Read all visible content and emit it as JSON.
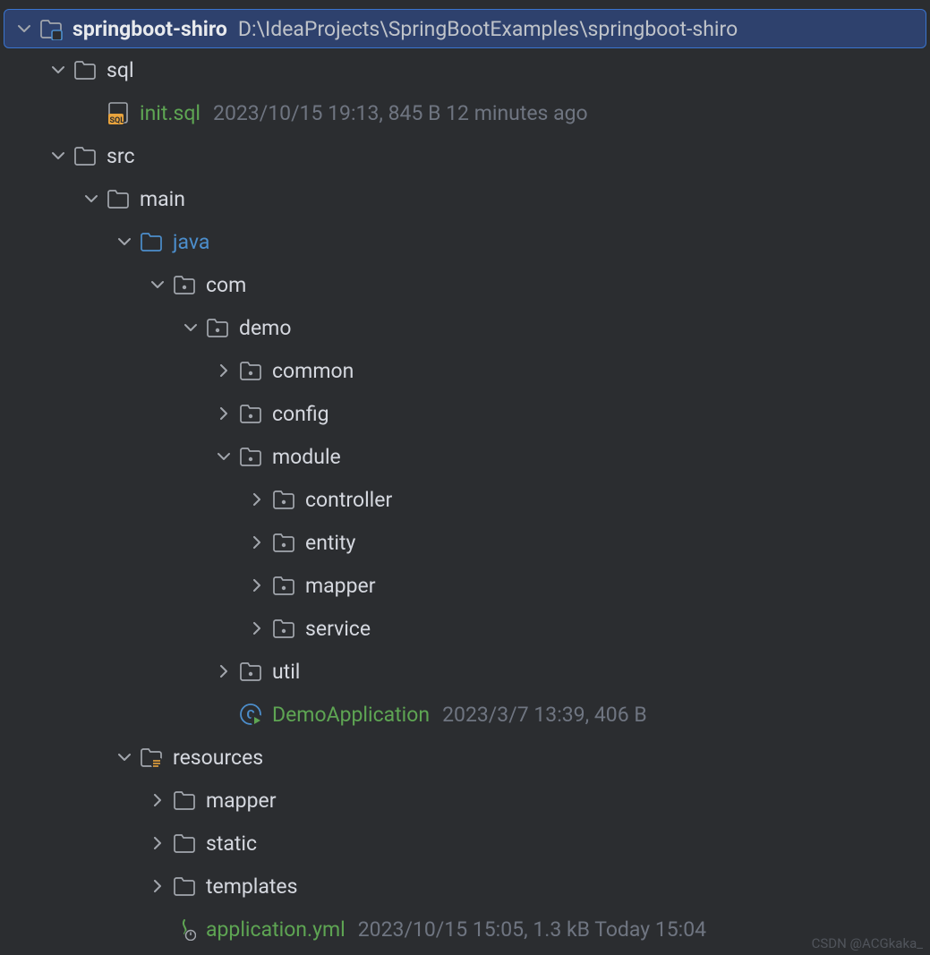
{
  "watermark": "CSDN @ACGkaka_",
  "tree": [
    {
      "indent": 0,
      "arrow": "down",
      "icon": "module",
      "label": "springboot-shiro",
      "labelClass": "bold",
      "path": "D:\\IdeaProjects\\SpringBootExamples\\springboot-shiro",
      "root": true
    },
    {
      "indent": 1,
      "arrow": "down",
      "icon": "folder",
      "label": "sql"
    },
    {
      "indent": 2,
      "arrow": "blank",
      "icon": "sql",
      "label": "init.sql",
      "labelClass": "green",
      "meta": "2023/10/15 19:13, 845 B 12 minutes ago"
    },
    {
      "indent": 1,
      "arrow": "down",
      "icon": "folder",
      "label": "src"
    },
    {
      "indent": 2,
      "arrow": "down",
      "icon": "folder",
      "label": "main"
    },
    {
      "indent": 3,
      "arrow": "down",
      "icon": "folder-source",
      "label": "java",
      "labelClass": "blue"
    },
    {
      "indent": 4,
      "arrow": "down",
      "icon": "package",
      "label": "com"
    },
    {
      "indent": 5,
      "arrow": "down",
      "icon": "package",
      "label": "demo"
    },
    {
      "indent": 6,
      "arrow": "right",
      "icon": "package",
      "label": "common"
    },
    {
      "indent": 6,
      "arrow": "right",
      "icon": "package",
      "label": "config"
    },
    {
      "indent": 6,
      "arrow": "down",
      "icon": "package",
      "label": "module"
    },
    {
      "indent": 7,
      "arrow": "right",
      "icon": "package",
      "label": "controller"
    },
    {
      "indent": 7,
      "arrow": "right",
      "icon": "package",
      "label": "entity"
    },
    {
      "indent": 7,
      "arrow": "right",
      "icon": "package",
      "label": "mapper"
    },
    {
      "indent": 7,
      "arrow": "right",
      "icon": "package",
      "label": "service"
    },
    {
      "indent": 6,
      "arrow": "right",
      "icon": "package",
      "label": "util"
    },
    {
      "indent": 6,
      "arrow": "blank",
      "icon": "class-run",
      "label": "DemoApplication",
      "labelClass": "green",
      "meta": "2023/3/7 13:39, 406 B"
    },
    {
      "indent": 3,
      "arrow": "down",
      "icon": "resources",
      "label": "resources"
    },
    {
      "indent": 4,
      "arrow": "right",
      "icon": "folder",
      "label": "mapper"
    },
    {
      "indent": 4,
      "arrow": "right",
      "icon": "folder",
      "label": "static"
    },
    {
      "indent": 4,
      "arrow": "right",
      "icon": "folder",
      "label": "templates"
    },
    {
      "indent": 4,
      "arrow": "blank",
      "icon": "yml",
      "label": "application.yml",
      "labelClass": "green",
      "meta": "2023/10/15 15:05, 1.3 kB Today 15:04"
    }
  ]
}
